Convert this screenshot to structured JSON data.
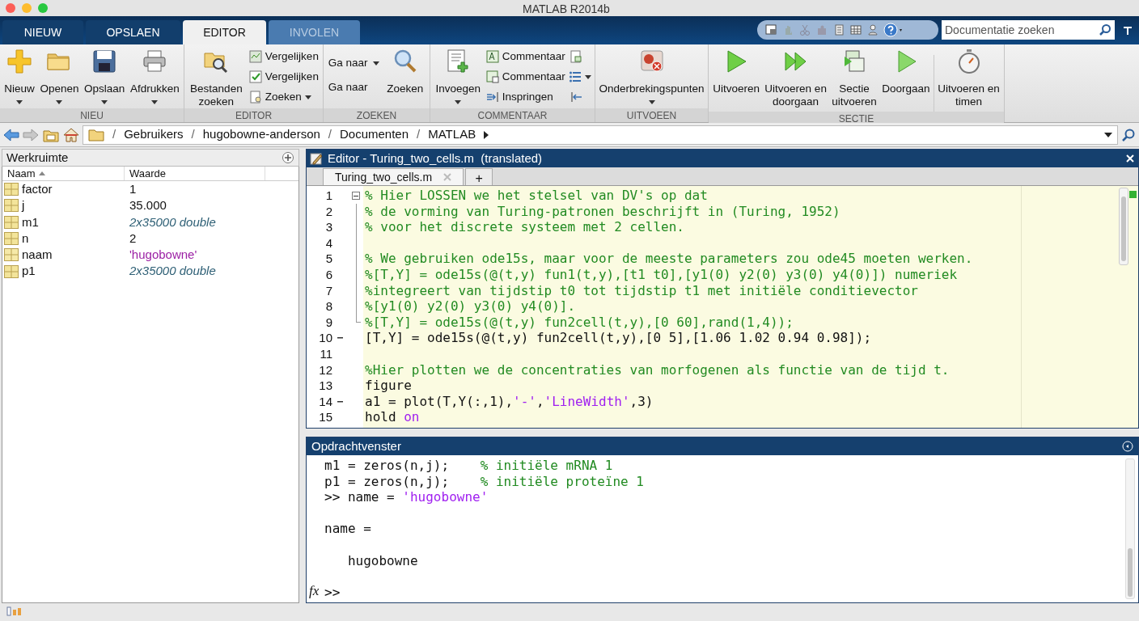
{
  "window": {
    "title": "MATLAB R2014b"
  },
  "tabs": [
    {
      "label": "NIEUW",
      "selected": false,
      "disabled": false
    },
    {
      "label": "OPSLAEN",
      "selected": false,
      "disabled": false
    },
    {
      "label": "EDITOR",
      "selected": true,
      "disabled": false
    },
    {
      "label": "INVOLEN",
      "selected": false,
      "disabled": true
    }
  ],
  "doc_search": {
    "placeholder": "Documentatie zoeken"
  },
  "ribbon": [
    {
      "label": "NIEU",
      "items": [
        {
          "kind": "large",
          "label": "Nieuw",
          "caret": true
        },
        {
          "kind": "large",
          "label": "Openen",
          "caret": true
        },
        {
          "kind": "large",
          "label": "Opslaan",
          "caret": true
        },
        {
          "kind": "large",
          "label": "Afdrukken",
          "caret": true
        }
      ]
    },
    {
      "label": "EDITOR",
      "items": [
        {
          "kind": "large",
          "label": "Bestanden\nzoeken",
          "caret": false
        },
        {
          "kind": "stack",
          "items": [
            {
              "label": "Vergelijken",
              "caret": false
            },
            {
              "label": "Vergelijken",
              "caret": false
            },
            {
              "label": "Zoeken",
              "caret": true
            }
          ]
        }
      ]
    },
    {
      "label": "ZOEKEN",
      "items": [
        {
          "kind": "textstack",
          "items": [
            {
              "label": "Ga naar",
              "caret": true
            },
            {
              "label": "Ga naar",
              "caret": false
            }
          ]
        },
        {
          "kind": "large",
          "label": "Zoeken",
          "caret": false
        }
      ]
    },
    {
      "label": "COMMENTAAR",
      "items": [
        {
          "kind": "large",
          "label": "Invoegen",
          "caret": true
        },
        {
          "kind": "stack",
          "items": [
            {
              "label": "Commentaar",
              "caret": false
            },
            {
              "label": "Commentaar",
              "caret": false
            },
            {
              "label": "Inspringen",
              "caret": false
            }
          ]
        },
        {
          "kind": "iconstack",
          "items": [
            {
              "caret": false
            },
            {
              "caret": true
            },
            {
              "caret": false
            }
          ]
        }
      ]
    },
    {
      "label": "UITVOEEN",
      "items": [
        {
          "kind": "large",
          "label": "Onderbrekingspunten",
          "caret": true
        }
      ]
    },
    {
      "label": "SECTIE",
      "items": [
        {
          "kind": "large",
          "label": "Uitvoeren",
          "caret": false
        },
        {
          "kind": "large",
          "label": "Uitvoeren en\ndoorgaan",
          "caret": false
        },
        {
          "kind": "large",
          "label": "Sectie\nuitvoeren",
          "caret": false
        },
        {
          "kind": "large",
          "label": "Doorgaan",
          "caret": false
        },
        {
          "kind": "separator"
        },
        {
          "kind": "large",
          "label": "Uitvoeren en\ntimen",
          "caret": false
        }
      ]
    }
  ],
  "path": [
    {
      "separator": "/",
      "label": "Gebruikers"
    },
    {
      "separator": "/",
      "label": "hugobowne-anderson"
    },
    {
      "separator": "/",
      "label": "Documenten"
    },
    {
      "separator": "/",
      "label": "MATLAB"
    }
  ],
  "workspace": {
    "title": "Werkruimte",
    "columns": [
      "Naam",
      "Waarde"
    ],
    "rows": [
      {
        "name": "factor",
        "value": "1",
        "kind": "number"
      },
      {
        "name": "j",
        "value": "35.000",
        "kind": "number"
      },
      {
        "name": "m1",
        "value": "2x35000 double",
        "kind": "array"
      },
      {
        "name": "n",
        "value": "2",
        "kind": "number"
      },
      {
        "name": "naam",
        "value": "'hugobowne'",
        "kind": "string"
      },
      {
        "name": "p1",
        "value": "2x35000 double",
        "kind": "array"
      }
    ]
  },
  "editor": {
    "title": "Editor - Turing_two_cells.m  (translated)",
    "file_tab": "Turing_two_cells.m",
    "add_tab": "+",
    "lines": [
      {
        "no": "1",
        "breakpoint": false,
        "fold_toggle": true,
        "in_fold": false,
        "segments": [
          {
            "kind": "comment",
            "text": "% Hier LOSSEN we het stelsel van DV's op dat"
          }
        ]
      },
      {
        "no": "2",
        "breakpoint": false,
        "fold_toggle": false,
        "in_fold": true,
        "segments": [
          {
            "kind": "comment",
            "text": "% de vorming van Turing-patronen beschrijft in (Turing, 1952)"
          }
        ]
      },
      {
        "no": "3",
        "breakpoint": false,
        "fold_toggle": false,
        "in_fold": true,
        "segments": [
          {
            "kind": "comment",
            "text": "% voor het discrete systeem met 2 cellen."
          }
        ]
      },
      {
        "no": "4",
        "breakpoint": false,
        "fold_toggle": false,
        "in_fold": true
      },
      {
        "no": "5",
        "breakpoint": false,
        "fold_toggle": false,
        "in_fold": true,
        "segments": [
          {
            "kind": "comment",
            "text": "% We gebruiken ode15s, maar voor de meeste parameters zou ode45 moeten werken."
          }
        ]
      },
      {
        "no": "6",
        "breakpoint": false,
        "fold_toggle": false,
        "in_fold": true,
        "segments": [
          {
            "kind": "comment",
            "text": "%[T,Y] = ode15s(@(t,y) fun1(t,y),[t1 t0],[y1(0) y2(0) y3(0) y4(0)]) numeriek"
          }
        ]
      },
      {
        "no": "7",
        "breakpoint": false,
        "fold_toggle": false,
        "in_fold": true,
        "segments": [
          {
            "kind": "comment",
            "text": "%integreert van tijdstip t0 tot tijdstip t1 met initiële conditievector"
          }
        ]
      },
      {
        "no": "8",
        "breakpoint": false,
        "fold_toggle": false,
        "in_fold": true,
        "segments": [
          {
            "kind": "comment",
            "text": "%[y1(0) y2(0) y3(0) y4(0)]."
          }
        ]
      },
      {
        "no": "9",
        "breakpoint": false,
        "fold_toggle": false,
        "in_fold": true,
        "segments": [
          {
            "kind": "comment",
            "text": "%[T,Y] = ode15s(@(t,y) fun2cell(t,y),[0 60],rand(1,4));"
          }
        ]
      },
      {
        "no": "10",
        "breakpoint": true,
        "fold_toggle": false,
        "in_fold": false,
        "segments": [
          {
            "kind": "code",
            "text": "[T,Y] = ode15s(@(t,y) fun2cell(t,y),[0 5],[1.06 1.02 0.94 0.98]);"
          }
        ]
      },
      {
        "no": "11",
        "breakpoint": false,
        "fold_toggle": false,
        "in_fold": false
      },
      {
        "no": "12",
        "breakpoint": false,
        "fold_toggle": false,
        "in_fold": false,
        "segments": [
          {
            "kind": "comment",
            "text": "%Hier plotten we de concentraties van morfogenen als functie van de tijd t."
          }
        ]
      },
      {
        "no": "13",
        "breakpoint": false,
        "fold_toggle": false,
        "in_fold": false,
        "segments": [
          {
            "kind": "code",
            "text": "figure"
          }
        ]
      },
      {
        "no": "14",
        "breakpoint": true,
        "fold_toggle": false,
        "in_fold": false,
        "segments": [
          {
            "kind": "code",
            "text": "a1 = plot(T,Y(:,1),"
          },
          {
            "kind": "string",
            "text": "'-'"
          },
          {
            "kind": "code",
            "text": ","
          },
          {
            "kind": "string",
            "text": "'LineWidth'"
          },
          {
            "kind": "code",
            "text": ",3)"
          }
        ]
      },
      {
        "no": "15",
        "breakpoint": false,
        "fold_toggle": false,
        "in_fold": false,
        "segments": [
          {
            "kind": "code",
            "text": "hold "
          },
          {
            "kind": "string",
            "text": "on"
          }
        ]
      }
    ]
  },
  "command_window": {
    "title": "Opdrachtvenster",
    "lines": [
      {
        "kind": "text",
        "segments": [
          {
            "kind": "code",
            "text": "m1 = zeros(n,j);    "
          },
          {
            "kind": "comment",
            "text": "% initiële mRNA 1"
          }
        ]
      },
      {
        "kind": "text",
        "segments": [
          {
            "kind": "code",
            "text": "p1 = zeros(n,j);    "
          },
          {
            "kind": "comment",
            "text": "% initiële proteïne 1"
          }
        ]
      },
      {
        "kind": "text",
        "segments": [
          {
            "kind": "code",
            "text": ">> name = "
          },
          {
            "kind": "string",
            "text": "'hugobowne'"
          }
        ]
      },
      {
        "kind": "blank"
      },
      {
        "kind": "text",
        "segments": [
          {
            "kind": "code",
            "text": "name ="
          }
        ]
      },
      {
        "kind": "blank"
      },
      {
        "kind": "text",
        "segments": [
          {
            "kind": "code",
            "text": "   hugobowne"
          }
        ]
      },
      {
        "kind": "blank"
      }
    ],
    "prompt": "fx",
    "prompt_text": ">>"
  }
}
